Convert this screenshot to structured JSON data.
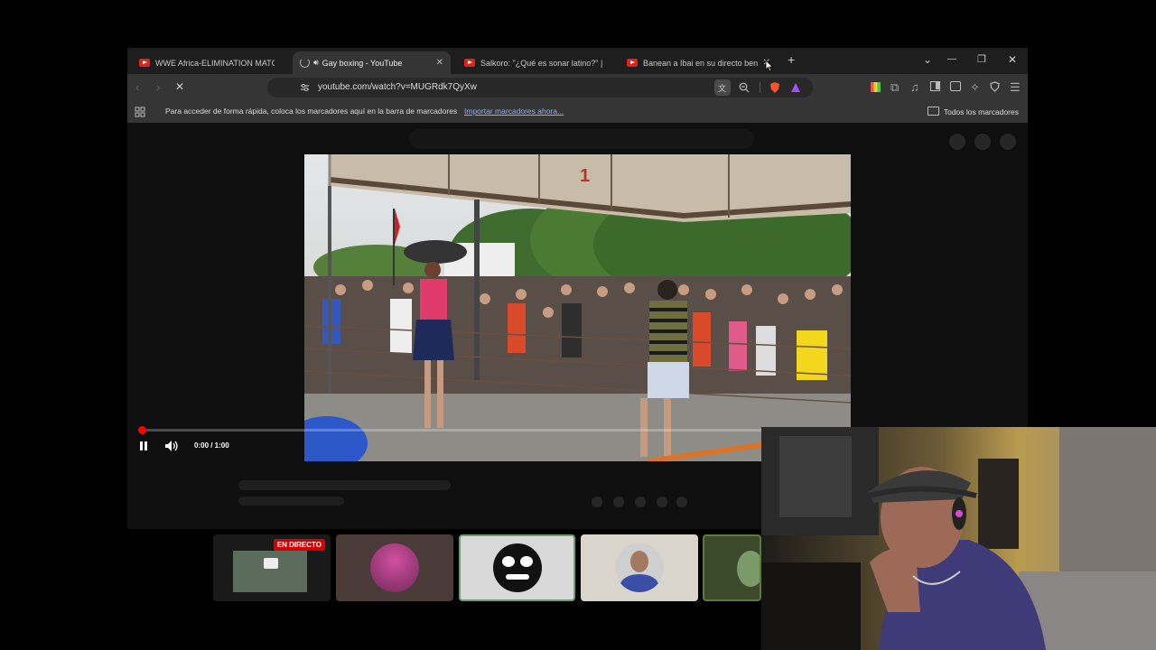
{
  "browser": {
    "tabs": [
      {
        "title": "WWE Africa-ELIMINATION MATCH",
        "active": false,
        "close": ""
      },
      {
        "title": "Gay boxing - YouTube",
        "active": true,
        "close": "✕"
      },
      {
        "title": "Salkoro: \"¿Qué es sonar latino?\" | En",
        "active": false,
        "close": ""
      },
      {
        "title": "Banean a Ibai en su directo ben",
        "active": false,
        "close": "✕"
      }
    ],
    "new_tab": "+",
    "window_controls": {
      "dropdown": "⌄",
      "minimize": "—",
      "restore": "❐",
      "close": "✕"
    },
    "url": "youtube.com/watch?v=MUGRdk7QyXw",
    "bookmarks_bar": {
      "prompt": "Para acceder de forma rápida, coloca los marcadores aquí en la barra de marcadores",
      "import_link": "Importar marcadores ahora...",
      "all_bookmarks": "Todos los marcadores"
    }
  },
  "player": {
    "time": "0:00 / 1:00",
    "progress_fraction": 0.005,
    "scene_sign": "1"
  },
  "strip": {
    "live_badge": "EN DIRECTO"
  },
  "colors": {
    "youtube_red": "#e62117",
    "live_red": "#d50000",
    "active_tab": "#353535"
  }
}
